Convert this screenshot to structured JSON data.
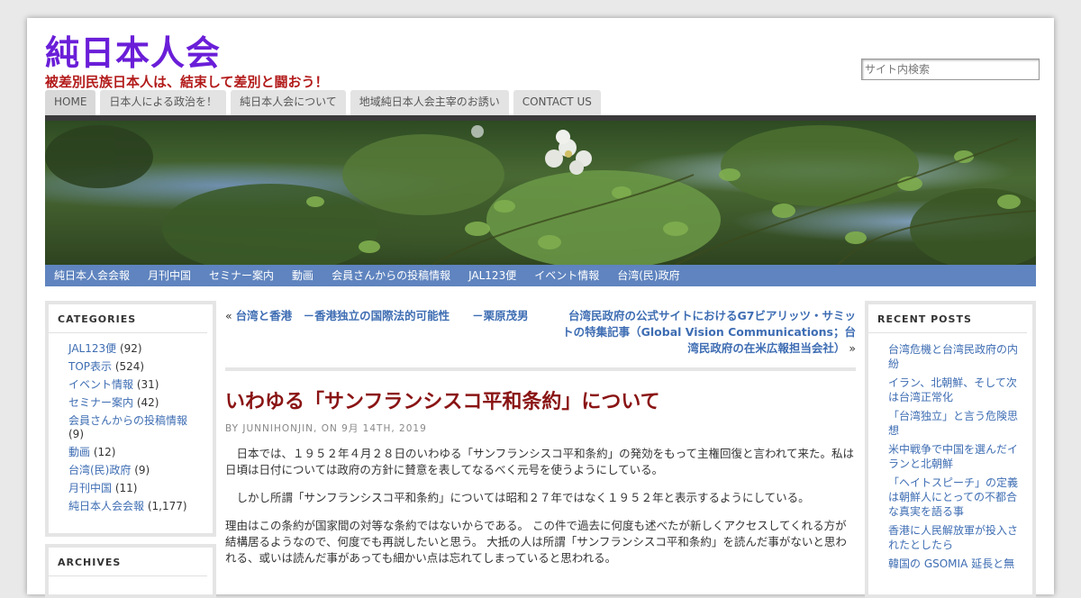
{
  "header": {
    "site_title": "純日本人会",
    "site_description": "被差別民族日本人は、結束して差別と闘おう！",
    "search_placeholder": "サイト内検索"
  },
  "top_nav": [
    "HOME",
    "日本人による政治を！",
    "純日本人会について",
    "地域純日本人会主宰のお誘い",
    "CONTACT US"
  ],
  "category_nav": [
    "純日本人会会報",
    "月刊中国",
    "セミナー案内",
    "動画",
    "会員さんからの投稿情報",
    "JAL123便",
    "イベント情報",
    "台湾(民)政府"
  ],
  "sidebar_left": {
    "categories_title": "CATEGORIES",
    "categories": [
      {
        "name": "JAL123便",
        "count": "(92)"
      },
      {
        "name": "TOP表示",
        "count": "(524)"
      },
      {
        "name": "イベント情報",
        "count": "(31)"
      },
      {
        "name": "セミナー案内",
        "count": "(42)"
      },
      {
        "name": "会員さんからの投稿情報",
        "count": "(9)"
      },
      {
        "name": "動画",
        "count": "(12)"
      },
      {
        "name": "台湾(民)政府",
        "count": "(9)"
      },
      {
        "name": "月刊中国",
        "count": "(11)"
      },
      {
        "name": "純日本人会会報",
        "count": "(1,177)"
      }
    ],
    "archives_title": "ARCHIVES"
  },
  "post_nav": {
    "prev_marker": "«",
    "prev_title": "台湾と香港　－香港独立の国際法的可能性　　－栗原茂男",
    "next_title": "台湾民政府の公式サイトにおけるG7ビアリッツ・サミットの特集記事（Global Vision Communications；台湾民政府の在米広報担当会社）",
    "next_marker": "»"
  },
  "post": {
    "title": "いわゆる「サンフランシスコ平和条約」について",
    "byline": "BY JUNNIHONJIN, ON 9月 14TH, 2019",
    "paragraphs": [
      "　日本では、１９５２年４月２８日のいわゆる「サンフランシスコ平和条約」の発効をもって主権回復と言われて来た。私は日頃は日付については政府の方針に賛意を表してなるべく元号を使うようにしている。",
      "　しかし所謂「サンフランシスコ平和条約」については昭和２７年ではなく１９５２年と表示するようにしている。",
      "理由はこの条約が国家間の対等な条約ではないからである。 この件で過去に何度も述べたが新しくアクセスしてくれる方が結構居るようなので、何度でも再説したいと思う。 大抵の人は所謂「サンフランシスコ平和条約」を読んだ事がないと思われる、或いは読んだ事があっても細かい点は忘れてしまっていると思われる。"
    ]
  },
  "sidebar_right": {
    "recent_title": "RECENT POSTS",
    "recent_posts": [
      "台湾危機と台湾民政府の内紛",
      "イラン、北朝鮮、そして次は台湾正常化",
      "「台湾独立」と言う危険思想",
      "米中戦争で中国を選んだイランと北朝鮮",
      "「ヘイトスピーチ」の定義は朝鮮人にとっての不都合な真実を語る事",
      "香港に人民解放軍が投入されたとしたら",
      "韓国の GSOMIA 延長と無"
    ]
  }
}
